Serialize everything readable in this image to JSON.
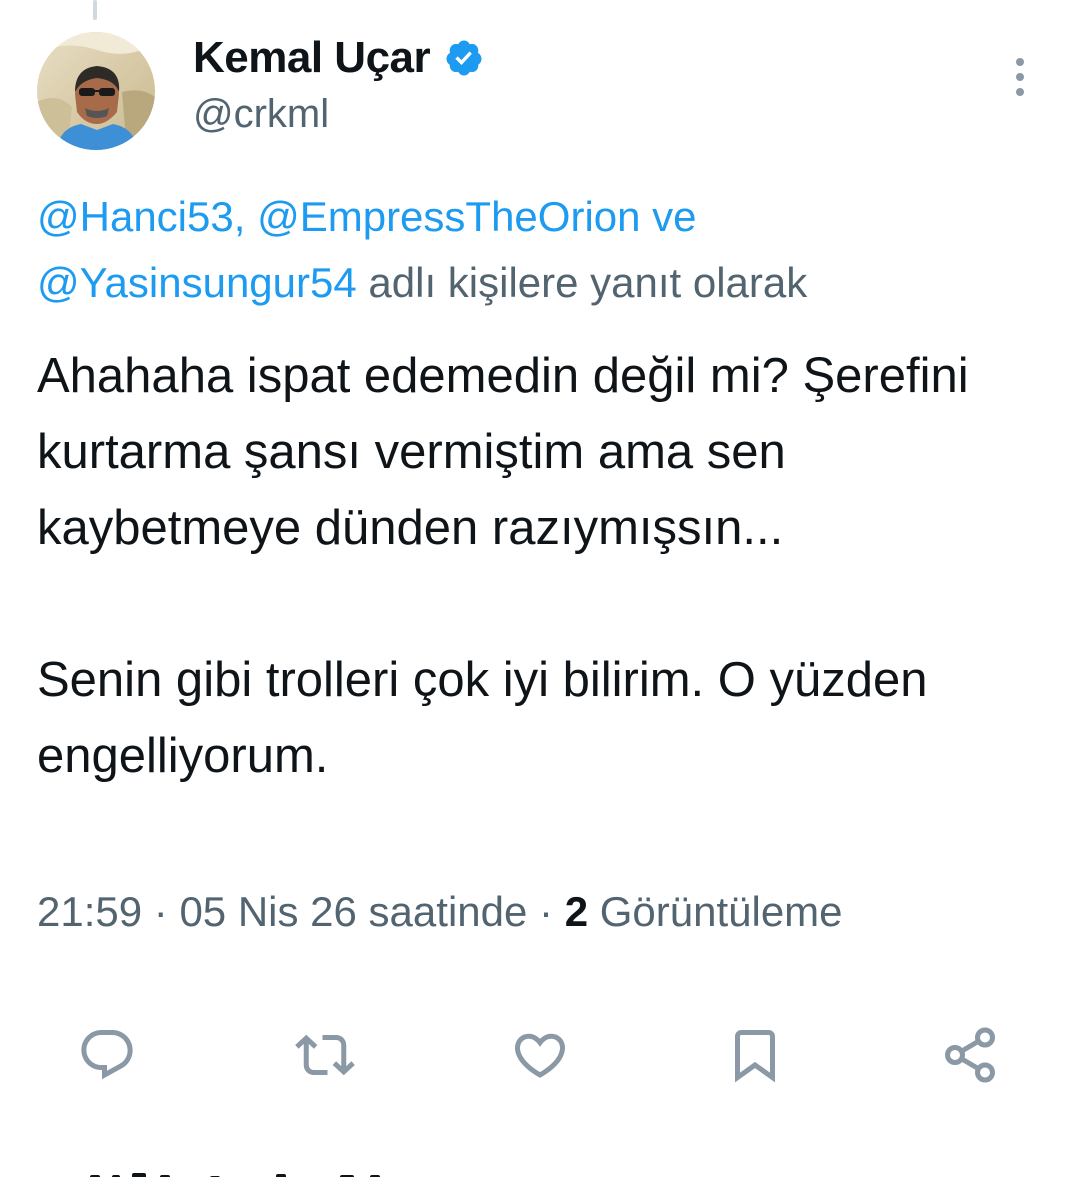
{
  "author": {
    "display_name": "Kemal Uçar",
    "handle": "@crkml",
    "verified": true,
    "avatar_icon": "user-avatar-photo"
  },
  "reply_to": {
    "mentions": [
      "@Hanci53",
      "@EmpressTheOrion",
      "@Yasinsungur54"
    ],
    "separator": ",",
    "conjunction": "ve",
    "suffix": "adlı kişilere yanıt olarak"
  },
  "tweet": {
    "paragraphs": [
      "Ahahaha ispat edemedin değil mi? Şerefini kurtarma şansı vermiştim ama sen kaybetmeye dünden razıymışsın...",
      "Senin gibi trolleri çok iyi bilirim. O yüzden engelliyorum."
    ]
  },
  "meta": {
    "time": "21:59",
    "dot": "·",
    "date": "05 Nis 26 saatinde",
    "views_count": "2",
    "views_label": "Görüntüleme"
  },
  "actions": [
    {
      "name": "reply",
      "icon": "reply-icon"
    },
    {
      "name": "retweet",
      "icon": "retweet-icon"
    },
    {
      "name": "like",
      "icon": "heart-icon"
    },
    {
      "name": "bookmark",
      "icon": "bookmark-icon"
    },
    {
      "name": "share",
      "icon": "share-icon"
    }
  ],
  "colors": {
    "accent": "#1d9bf0",
    "secondary_text": "#536471",
    "primary_text": "#0f1419",
    "icon": "#536471"
  }
}
